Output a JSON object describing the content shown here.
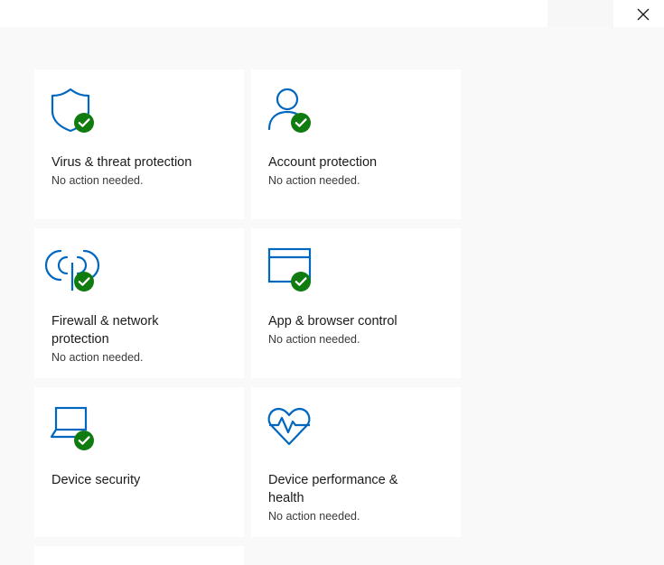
{
  "window": {
    "close_icon": "close-icon"
  },
  "tiles": [
    {
      "title": "Virus & threat protection",
      "status": "No action needed.",
      "icon": "shield-icon",
      "badge": "checkmark-icon"
    },
    {
      "title": "Account protection",
      "status": "No action needed.",
      "icon": "person-icon",
      "badge": "checkmark-icon"
    },
    {
      "title": "Firewall & network protection",
      "status": "No action needed.",
      "icon": "wifi-antenna-icon",
      "badge": "checkmark-icon"
    },
    {
      "title": "App & browser control",
      "status": "No action needed.",
      "icon": "browser-window-icon",
      "badge": "checkmark-icon"
    },
    {
      "title": "Device security",
      "status": "",
      "icon": "laptop-icon",
      "badge": "checkmark-icon"
    },
    {
      "title": "Device performance & health",
      "status": "No action needed.",
      "icon": "heart-pulse-icon"
    }
  ],
  "colors": {
    "accent": "#0067c0",
    "ok_green": "#107c10",
    "tile_bg": "#ffffff",
    "page_bg": "#f9f9f9"
  }
}
